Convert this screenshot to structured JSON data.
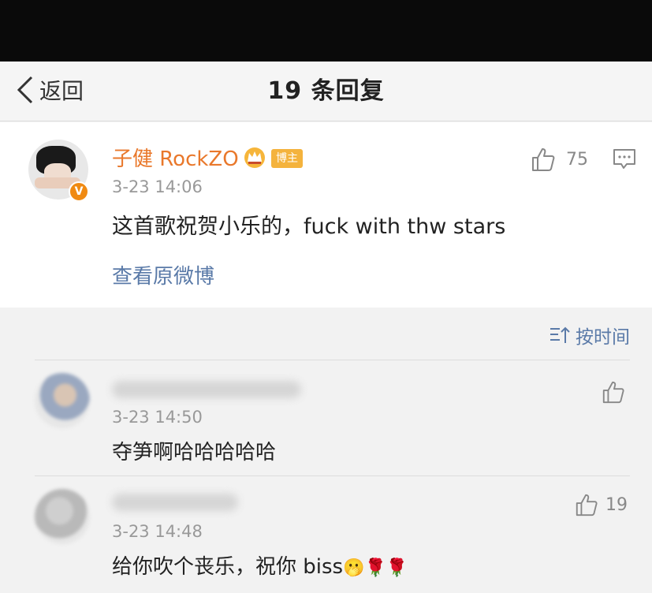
{
  "nav": {
    "back_label": "返回",
    "title": "19 条回复"
  },
  "main_post": {
    "author": "子健 RockZO",
    "badge": "博主",
    "verified_badge": "V",
    "time": "3-23 14:06",
    "text": "这首歌祝贺小乐的，fuck with thw stars",
    "likes": "75",
    "view_original": "查看原微博",
    "icons": [
      "thumbs-up-icon",
      "comment-icon",
      "crown-icon"
    ]
  },
  "sort": {
    "label": "按时间",
    "icon": "sort-icon"
  },
  "replies": [
    {
      "time": "3-23 14:50",
      "text": "夺笋啊哈哈哈哈哈",
      "likes": ""
    },
    {
      "time": "3-23 14:48",
      "text": "给你吹个丧乐，祝你 biss",
      "emoji": "🫢🌹🌹",
      "likes": "19"
    }
  ],
  "colors": {
    "author_orange": "#e9782b",
    "link_blue": "#5a7aa8",
    "badge_gold": "#f4b33d",
    "verified_orange": "#f08a12"
  }
}
